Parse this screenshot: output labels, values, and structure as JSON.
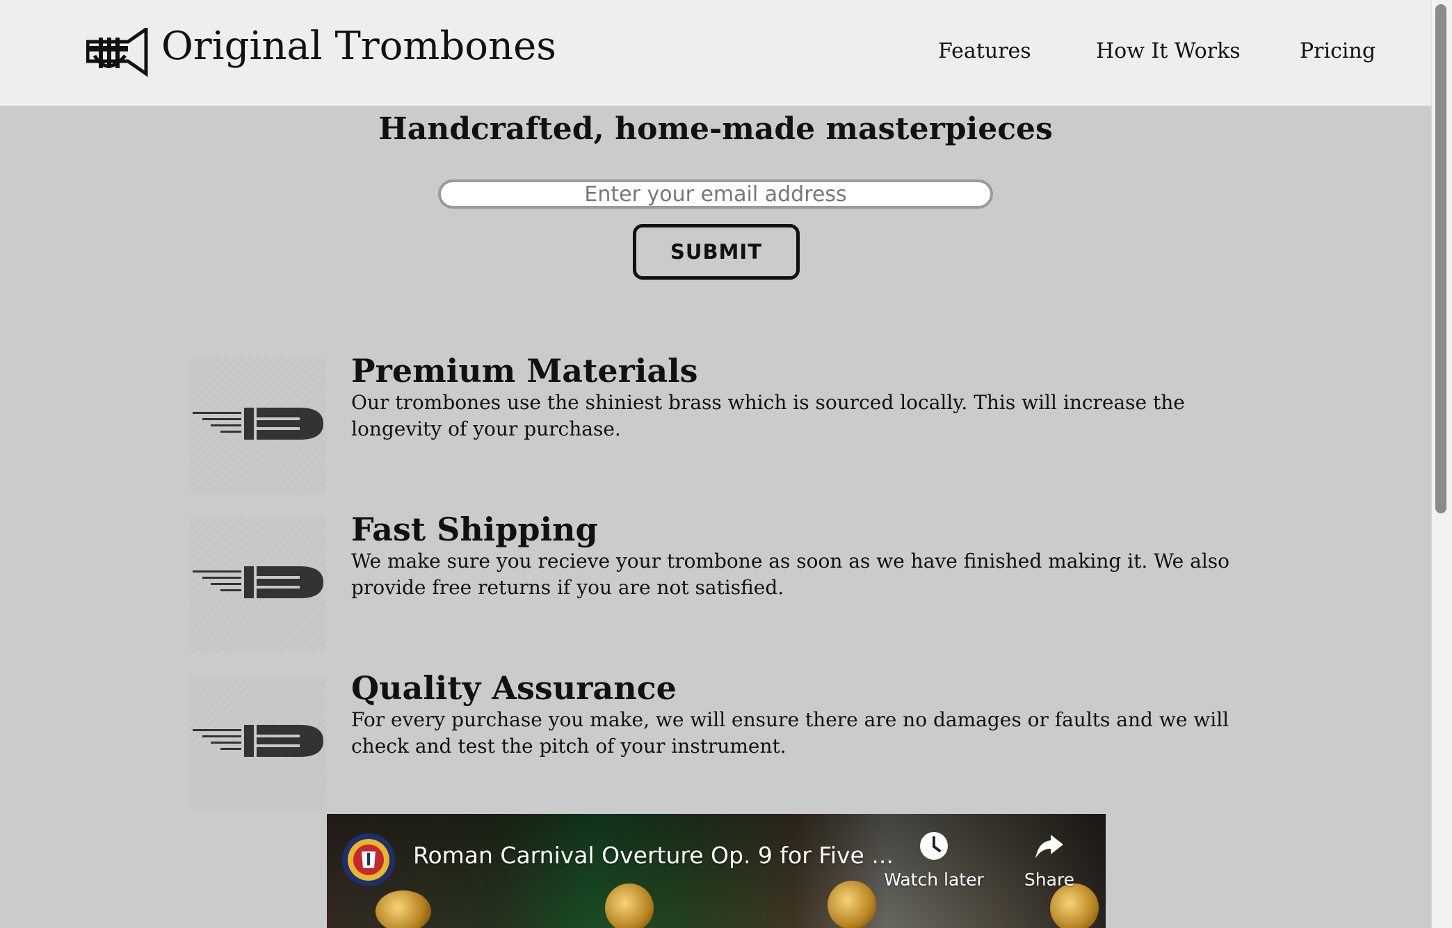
{
  "header": {
    "brand": "Original Trombones",
    "logo_icon": "trumpet-icon",
    "nav": [
      {
        "label": "Features"
      },
      {
        "label": "How It Works"
      },
      {
        "label": "Pricing"
      }
    ]
  },
  "hero": {
    "title": "Handcrafted, home-made masterpieces",
    "email_placeholder": "Enter your email address",
    "submit_label": "SUBMIT"
  },
  "features": [
    {
      "icon": "fast-bullet-icon",
      "title": "Premium Materials",
      "description": "Our trombones use the shiniest brass which is sourced locally. This will increase the longevity of your purchase."
    },
    {
      "icon": "fast-bullet-icon",
      "title": "Fast Shipping",
      "description": "We make sure you recieve your trombone as soon as we have finished making it. We also provide free returns if you are not satisfied."
    },
    {
      "icon": "fast-bullet-icon",
      "title": "Quality Assurance",
      "description": "For every purchase you make, we will ensure there are no damages or faults and we will check and test the pitch of your instrument."
    }
  ],
  "video": {
    "title": "Roman Carnival Overture Op. 9 for Five ...",
    "watch_later_label": "Watch later",
    "share_label": "Share",
    "watch_later_icon": "clock-icon",
    "share_icon": "share-arrow-icon",
    "channel_icon": "channel-avatar-icon"
  },
  "colors": {
    "page_background": "#cbcbcb",
    "header_background": "#eeeeee",
    "text": "#111111"
  }
}
